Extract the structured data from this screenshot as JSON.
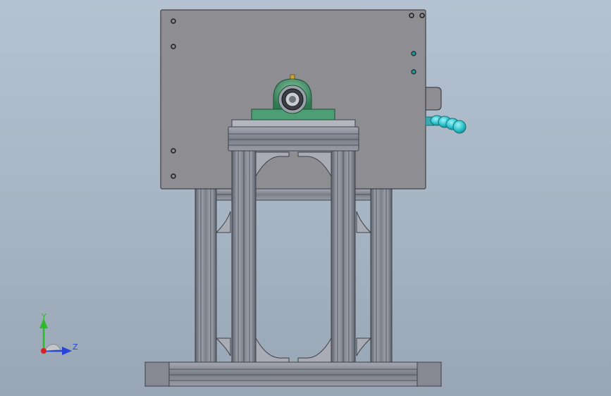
{
  "viewport": {
    "background_top": "#b4c2d1",
    "background_bottom": "#98a6b5"
  },
  "model": {
    "plate_color": "#8e8d92",
    "frame_color": "#8b8e99",
    "frame_dark": "#4a4d56",
    "bearing_color": "#3f8f66",
    "handle_color": "#29c4cc",
    "hole_color": "#2c2c2c",
    "indicator_color": "#1d9aa1"
  },
  "triad": {
    "y_label": "Y",
    "z_label": "Z",
    "y_color": "#2dbb2d",
    "z_color": "#2646d6",
    "x_color": "#d42424"
  }
}
